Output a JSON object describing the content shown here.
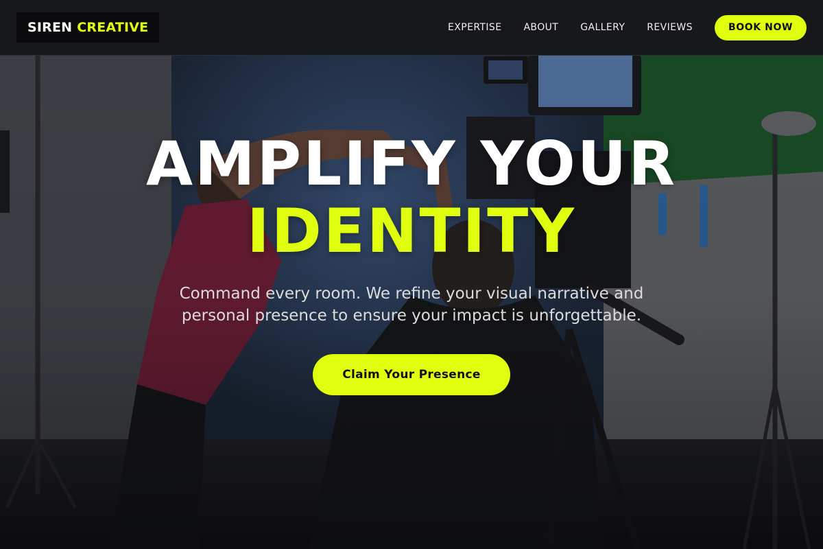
{
  "brand": {
    "name": "SIREN",
    "accent_name": "CREATIVE"
  },
  "nav": {
    "links": [
      "EXPERTISE",
      "ABOUT",
      "GALLERY",
      "REVIEWS"
    ],
    "cta_label": "BOOK NOW"
  },
  "hero": {
    "headline_line1": "AMPLIFY YOUR",
    "headline_line2": "IDENTITY",
    "subtext": "Command every room. We refine your visual narrative and personal presence to ensure your impact is unforgettable.",
    "cta_label": "Claim Your Presence",
    "background_image": "film studio scene with camera, monitor and green screen"
  },
  "colors": {
    "accent": "#dfff0e",
    "nav_background": "#18191d",
    "text_primary": "#ffffff",
    "text_secondary": "#dcdcdc"
  }
}
